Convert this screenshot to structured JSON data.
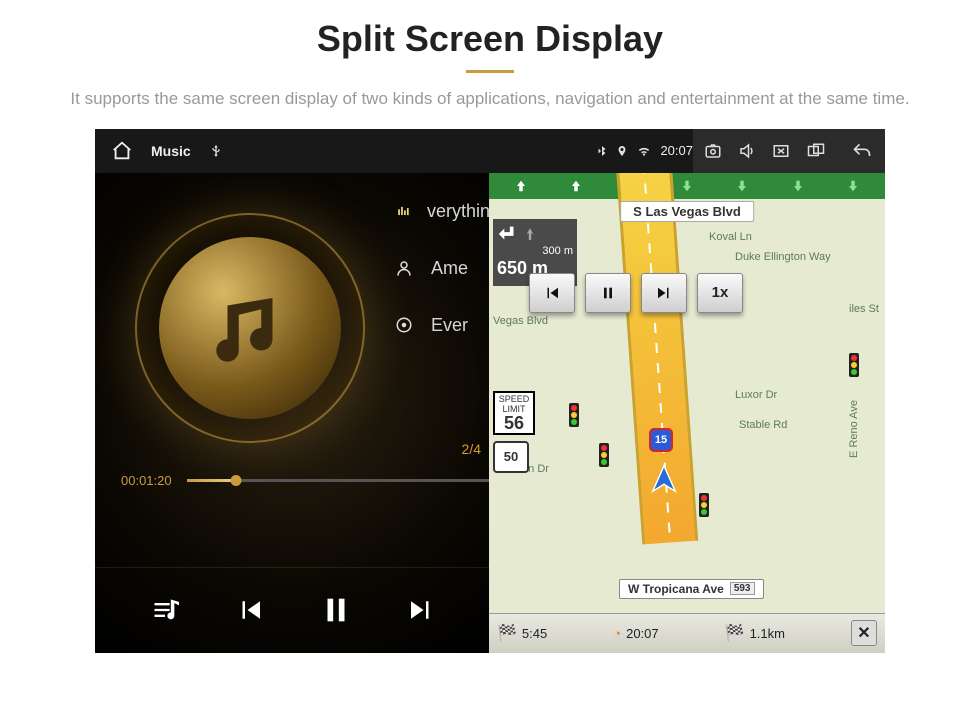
{
  "page": {
    "title": "Split Screen Display",
    "subtitle": "It supports the same screen display of two kinds of applications, navigation and entertainment at the same time."
  },
  "status": {
    "app_label": "Music",
    "clock": "20:07"
  },
  "music": {
    "tracks": {
      "t1": "verythin",
      "t2": "Ame",
      "t3": "Ever"
    },
    "counter": "2/4",
    "elapsed": "00:01:20"
  },
  "nav": {
    "street_top": "S Las Vegas Blvd",
    "turn": {
      "d1": "300 m",
      "d2": "650 m"
    },
    "speed_limit": {
      "label": "SPEED LIMIT",
      "value": "56"
    },
    "route_shield": "50",
    "highway": "15",
    "playback_speed": "1x",
    "street_bottom": "W Tropicana Ave",
    "exit_no": "593",
    "labels": {
      "koval": "Koval Ln",
      "duke": "Duke Ellington Way",
      "vegas": "Vegas Blvd",
      "giles": "iles St",
      "luxor": "Luxor Dr",
      "stable": "Stable Rd",
      "reno": "E Reno Ave",
      "martin": "rtin Dr"
    },
    "bottom": {
      "time": "5:45",
      "clock": "20:07",
      "dist": "1.1km"
    }
  }
}
